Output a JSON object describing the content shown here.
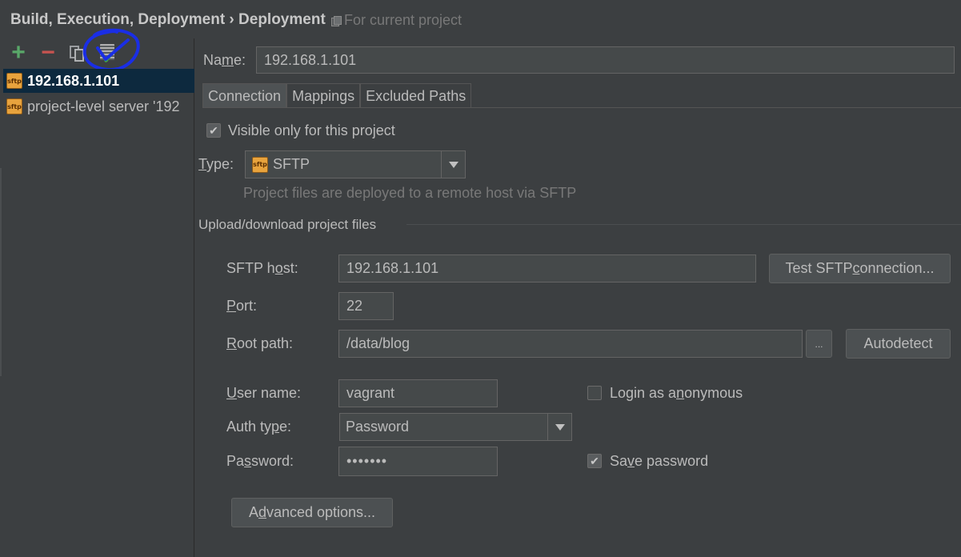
{
  "header": {
    "breadcrumb": "Build, Execution, Deployment › Deployment",
    "scope": "For current project"
  },
  "toolbar": {
    "add": "+",
    "remove": "−",
    "copy": "copy-icon",
    "use_as_default": "server-default-icon"
  },
  "servers": [
    {
      "label": "192.168.1.101",
      "icon": "sftp-icon",
      "selected": true
    },
    {
      "label": "project-level server '192",
      "icon": "sftp-icon",
      "selected": false
    }
  ],
  "form": {
    "name_label_pre": "Na",
    "name_label_mn": "m",
    "name_label_post": "e:",
    "name_value": "192.168.1.101",
    "tabs": [
      "Connection",
      "Mappings",
      "Excluded Paths"
    ],
    "active_tab": "Connection",
    "visible_only_label": "Visible only for this project",
    "visible_only_checked": true,
    "type_label_mn": "T",
    "type_label_post": "ype:",
    "type_value": "SFTP",
    "type_hint": "Project files are deployed to a remote host via SFTP",
    "section_title": "Upload/download project files",
    "host_label_pre": "SFTP h",
    "host_label_mn": "o",
    "host_label_post": "st:",
    "host_value": "192.168.1.101",
    "test_button_pre": "Test SFTP ",
    "test_button_mn": "c",
    "test_button_post": "onnection...",
    "port_label_mn": "P",
    "port_label_post": "ort:",
    "port_value": "22",
    "root_label_mn": "R",
    "root_label_post": "oot path:",
    "root_value": "/data/blog",
    "browse_label": "...",
    "autodetect_label": "Autodetect",
    "user_label_mn": "U",
    "user_label_post": "ser name:",
    "user_value": "vagrant",
    "anon_label_pre": "Login as a",
    "anon_label_mn": "n",
    "anon_label_post": "onymous",
    "anon_checked": false,
    "auth_label_pre": "Auth ty",
    "auth_label_mn": "p",
    "auth_label_post": "e:",
    "auth_value": "Password",
    "password_label_pre": "Pa",
    "password_label_mn": "s",
    "password_label_post": "sword:",
    "password_value": "•••••••",
    "save_password_pre": "Sa",
    "save_password_mn": "v",
    "save_password_post": "e password",
    "save_password_checked": true,
    "advanced_pre": "A",
    "advanced_mn": "d",
    "advanced_post": "vanced options..."
  },
  "colors": {
    "background": "#3c3f41",
    "selection": "#0d293e",
    "annotation": "#1a2ee6",
    "add": "#59a869",
    "remove": "#c75450"
  }
}
